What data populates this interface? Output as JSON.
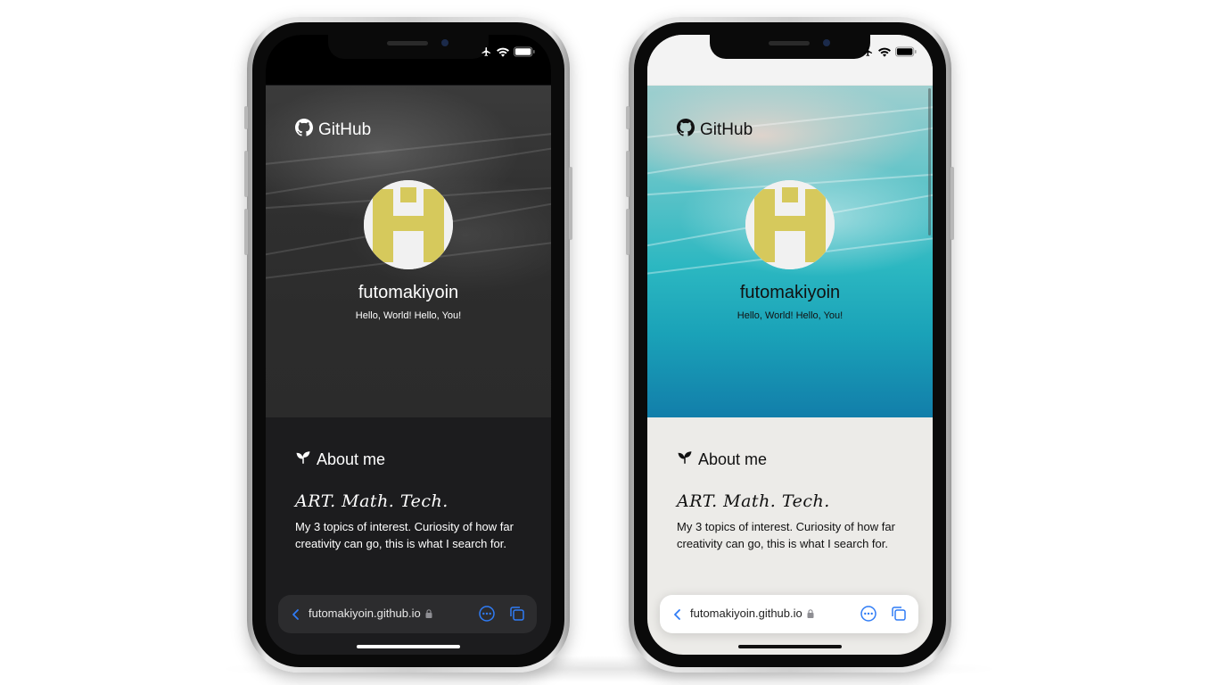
{
  "site": {
    "brand": "GitHub",
    "username": "futomakiyoin",
    "bio": "Hello, World! Hello, You!",
    "about_heading": "About me",
    "about_title": "ART. Math. Tech.",
    "about_text": "My 3 topics of interest. Curiosity of how far creativity can go, this is what I search for."
  },
  "browser": {
    "url": "futomakiyoin.github.io"
  },
  "icons": {
    "brand": "github-icon",
    "about": "sprout-icon",
    "back": "chevron-left-icon",
    "lock": "lock-icon",
    "more": "ellipsis-circle-icon",
    "tabs": "tabs-icon",
    "airplane": "airplane-icon",
    "wifi": "wifi-icon",
    "battery": "battery-icon"
  },
  "colors": {
    "accent_link": "#2f7cf6",
    "avatar_yellow": "#d6c95c",
    "dark_bg": "#1c1c1e",
    "light_bg": "#ecebe8"
  }
}
